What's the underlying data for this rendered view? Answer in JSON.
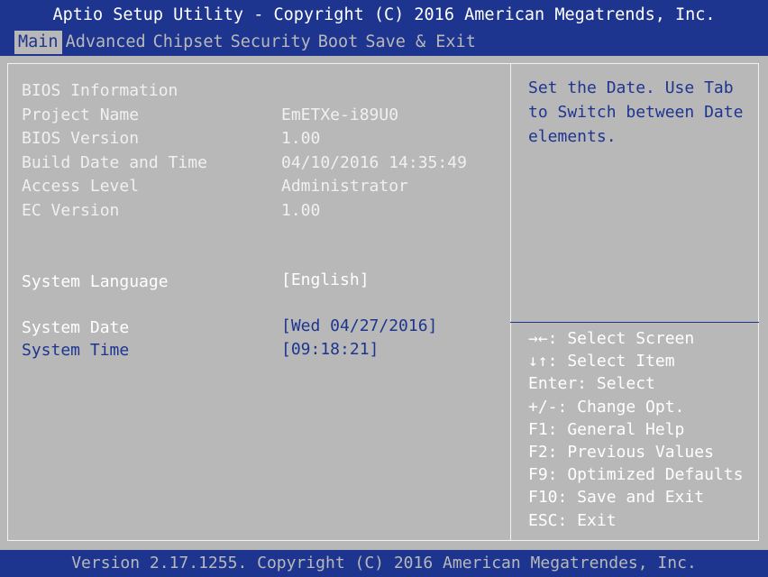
{
  "header": {
    "title": "Aptio Setup Utility - Copyright (C) 2016 American Megatrends, Inc.",
    "tabs": [
      "Main",
      "Advanced",
      "Chipset",
      "Security",
      "Boot",
      "Save & Exit"
    ],
    "active_tab": "Main"
  },
  "info": {
    "section_title": "BIOS Information",
    "rows": [
      {
        "label": "Project Name",
        "value": "EmETXe-i89U0"
      },
      {
        "label": "BIOS Version",
        "value": "1.00"
      },
      {
        "label": "Build Date and Time",
        "value": "04/10/2016 14:35:49"
      },
      {
        "label": "Access Level",
        "value": "Administrator"
      },
      {
        "label": "EC Version",
        "value": "1.00"
      }
    ]
  },
  "settings": {
    "language_label": "System Language",
    "language_value": "[English]",
    "date_label": "System Date",
    "date_value": "[Wed 04/27/2016]",
    "time_label": "System Time",
    "time_value": "[09:18:21]"
  },
  "help": {
    "text": "Set the Date. Use Tab\nto Switch between Date\nelements."
  },
  "keys": [
    "→←: Select Screen",
    "↓↑: Select Item",
    "Enter: Select",
    "+/-: Change Opt.",
    "F1: General Help",
    "F2: Previous Values",
    "F9: Optimized Defaults",
    "F10: Save and Exit",
    "ESC: Exit"
  ],
  "footer": {
    "version": "Version 2.17.1255. Copyright (C) 2016 American Megatrendes, Inc."
  },
  "colors": {
    "bar_blue": "#1e3590",
    "panel_gray": "#b8b8b8",
    "text_white": "#ffffff"
  }
}
